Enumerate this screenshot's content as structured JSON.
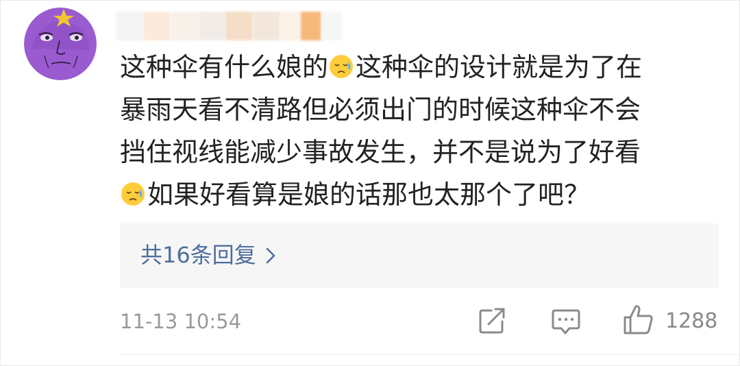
{
  "comment": {
    "username": "",
    "lines": [
      {
        "emoji_before": false,
        "segments": [
          "这种伞有什么娘的",
          "这种伞的设计就是为了在"
        ]
      },
      {
        "emoji_before": false,
        "segments": [
          "暴雨天看不清路但必须出门的时候这种伞不会"
        ]
      },
      {
        "emoji_before": false,
        "segments": [
          "挡住视线能减少事故发生，并不是说为了好看"
        ]
      },
      {
        "emoji_before": true,
        "segments": [
          "如果好看算是娘的话那也太那个了吧？"
        ]
      }
    ],
    "emoji_name": "sweat-face-emoji"
  },
  "replies": {
    "label": "共16条回复"
  },
  "footer": {
    "timestamp": "11-13 10:54",
    "like_count": "1288"
  },
  "colors": {
    "link": "#4d6d9c",
    "meta_text": "#999999",
    "avatar_bg": "#9b5bd0",
    "star": "#f2c530"
  }
}
